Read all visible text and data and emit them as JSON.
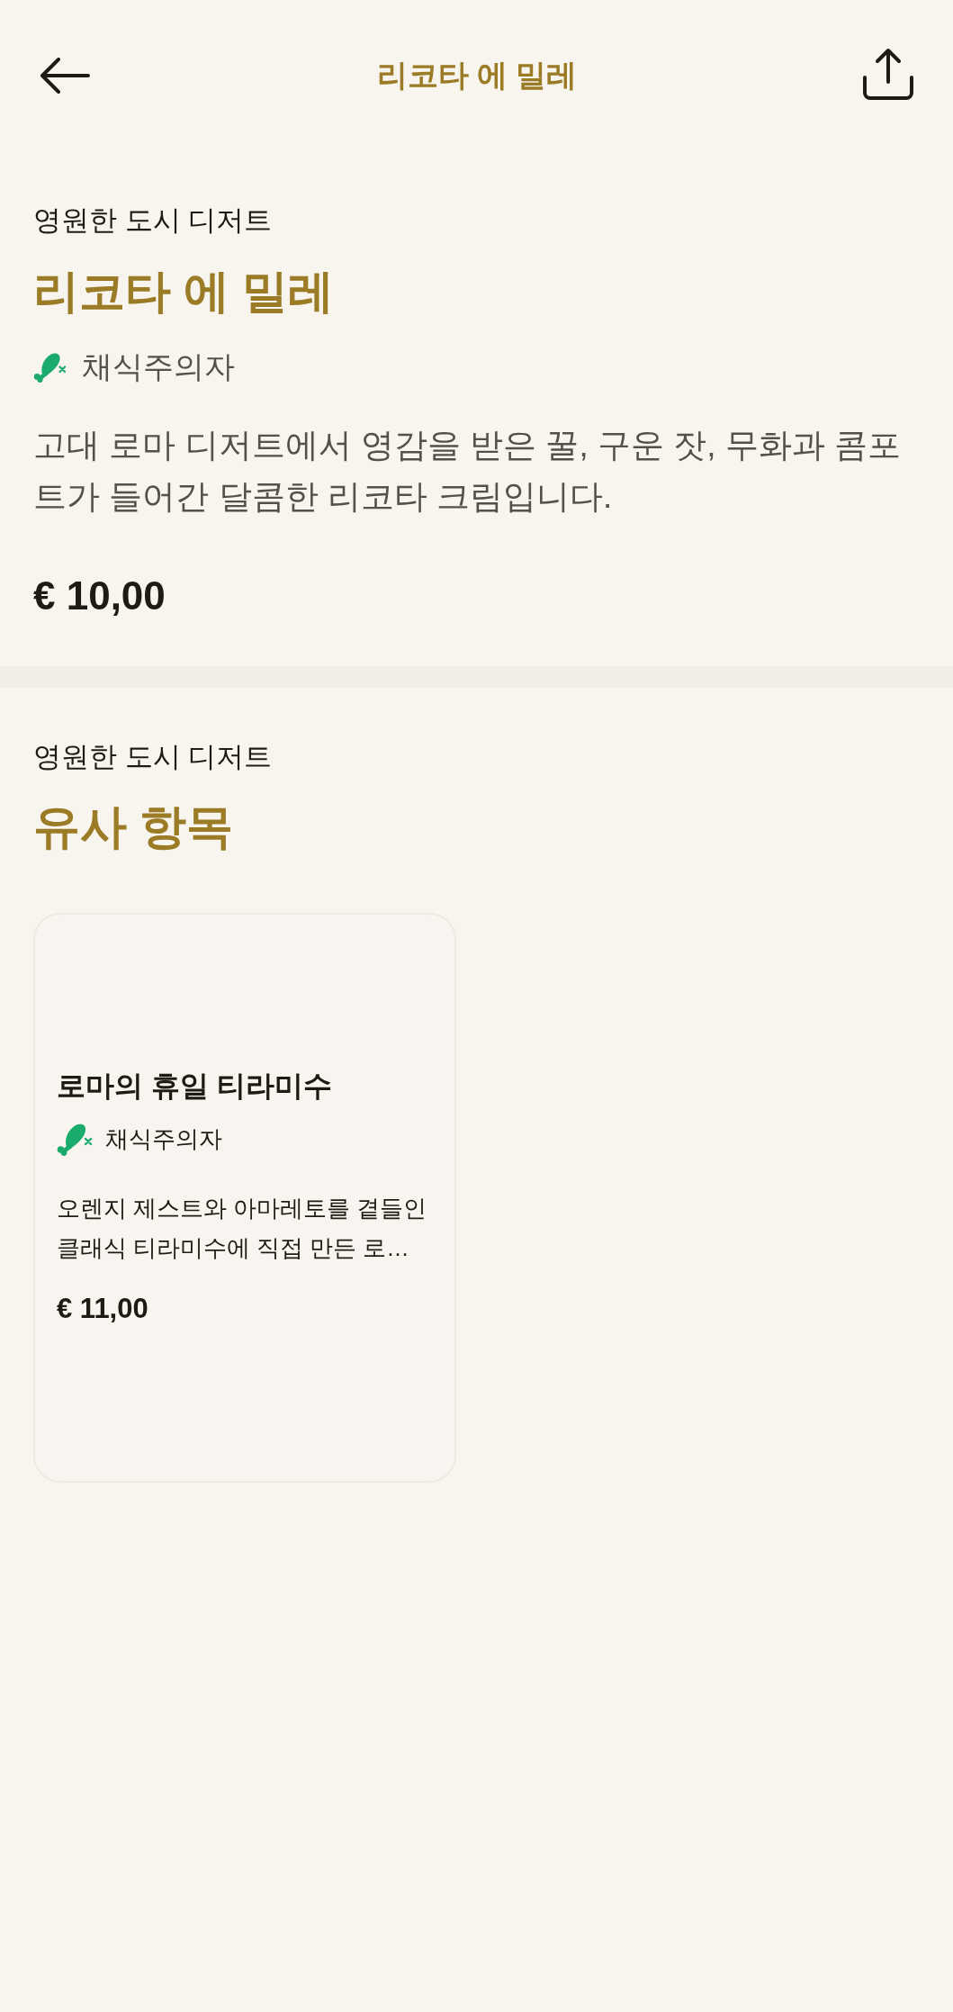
{
  "header": {
    "title": "리코타 에 밀레"
  },
  "dish": {
    "category": "영원한 도시 디저트",
    "name": "리코타 에 밀레",
    "tags": [
      {
        "kind": "vegetarian",
        "label": "채식주의자"
      }
    ],
    "description": "고대 로마 디저트에서 영감을 받은 꿀, 구운 잣, 무화과 콤포트가 들어간 달콤한 리코타 크림입니다.",
    "price": "€ 10,00"
  },
  "similar": {
    "category": "영원한 도시 디저트",
    "title": "유사 항목",
    "items": [
      {
        "name": "로마의 휴일 티라미수",
        "tags": [
          {
            "kind": "vegetarian",
            "label": "채식주의자"
          }
        ],
        "description": "오렌지 제스트와 아마레토를 곁들인 클래식 티라미수에 직접 만든 로…",
        "price": "€ 11,00"
      }
    ]
  }
}
